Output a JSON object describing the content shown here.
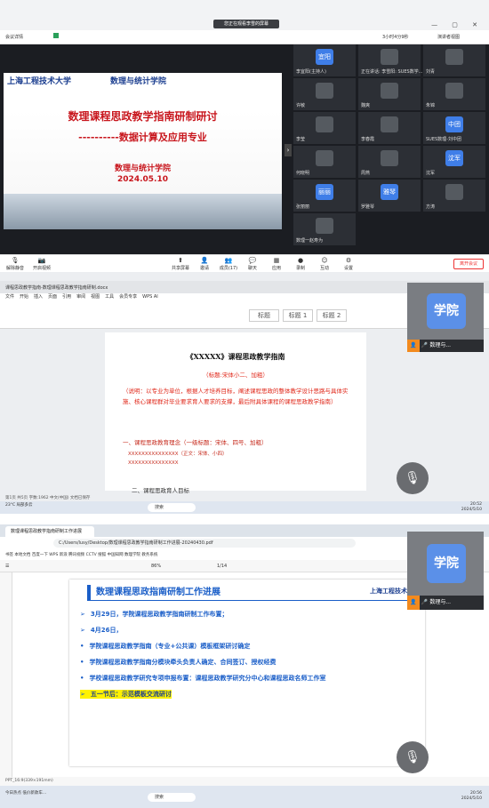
{
  "panel1": {
    "share_status": "您正在观看李雪的屏幕",
    "meeting_info": "会议详情",
    "timer": "3小时4分9秒",
    "view_label": "演讲者视图",
    "slide": {
      "school_name": "上海工程技术大学",
      "college_name": "数理与统计学院",
      "title": "数理课程思政教学指南研制研讨",
      "subtitle": "----------数据计算及应用专业",
      "college": "数理与统计学院",
      "date": "2024.05.10"
    },
    "participants": [
      {
        "avatar": "宜阳",
        "name": "李宜阳(主持人)",
        "color": "#3f7ee8"
      },
      {
        "avatar": "",
        "name": "正在讲话: 李雪阳: SUES数学...",
        "color": "#555a60"
      },
      {
        "avatar": "",
        "name": "刘青",
        "color": "#555a60"
      },
      {
        "avatar": "",
        "name": "许敏",
        "color": "#555a60"
      },
      {
        "avatar": "",
        "name": "魏爽",
        "color": "#555a60"
      },
      {
        "avatar": "",
        "name": "朱锦",
        "color": "#555a60"
      },
      {
        "avatar": "",
        "name": "李莹",
        "color": "#555a60"
      },
      {
        "avatar": "",
        "name": "李春霞",
        "color": "#555a60"
      },
      {
        "avatar": "中团",
        "name": "SUES数理-刘中团",
        "color": "#3f7ee8"
      },
      {
        "avatar": "",
        "name": "何晓明",
        "color": "#555a60"
      },
      {
        "avatar": "",
        "name": "周燕",
        "color": "#555a60"
      },
      {
        "avatar": "沈军",
        "name": "沈军",
        "color": "#3f7ee8"
      },
      {
        "avatar": "丽丽",
        "name": "张丽丽",
        "color": "#3f7ee8"
      },
      {
        "avatar": "雅琴",
        "name": "罗雅琴",
        "color": "#3f7ee8"
      },
      {
        "avatar": "",
        "name": "方涛",
        "color": "#555a60"
      },
      {
        "avatar": "",
        "name": "数理一赵寿为",
        "color": "#555a60"
      }
    ],
    "toolbar": {
      "mute": "解除静音",
      "video": "开启视频",
      "share": "共享屏幕",
      "invite": "邀请",
      "members": "成员(17)",
      "chat": "聊天",
      "apps": "应用",
      "record": "录制",
      "roles": "互动",
      "settings": "设置",
      "leave": "离开会议"
    }
  },
  "panel2": {
    "tab": "课程思政教学指南-数理课程思政教学指南研制.docx",
    "menus": [
      "文件",
      "开始",
      "插入",
      "页面",
      "引用",
      "审阅",
      "视图",
      "工具",
      "会员专享",
      "WPS AI"
    ],
    "styles": [
      "标题",
      "标题 1",
      "标题 2"
    ],
    "doc": {
      "heading": "《XXXXX》课程思政教学指南",
      "subheading": "（标题:宋体小二、加粗）",
      "description": "（说明：以专业为单位，根据人才培养目标，阐述课程思政的整体教学设计思路与具体实施、核心课程群对毕业要求育人要求的支撑，最后附具体课程的课程思政教学指南）",
      "section1": "一、课程思政教育理念（一级标题：宋体、四号、加粗）",
      "body1": "XXXXXXXXXXXXXXX（正文：宋体、小四）",
      "body2": "XXXXXXXXXXXXXXX",
      "section2": "二、课程思政育人目标"
    },
    "status": "第1页 共5页 字数:1962  中文(中国)  文档已保存",
    "taskbar_weather": "23°C 局部多云",
    "taskbar_search": "搜索",
    "clock_time": "20:52",
    "clock_date": "2024/5/10",
    "video_name": "学院",
    "video_label": "数理与..."
  },
  "panel3": {
    "tab": "数理课程思政教学指南研制工作进展",
    "url": "C:/Users/lusy/Desktop/数理课程思政教学指南研制工作进展-20240430.pdf",
    "bookmarks": "书签  本地文档  百度一下  WPS  新浪  腾讯视频  CCTV  搜狐  中国知网  数理学院  教务系统",
    "pdf_page": "1/14",
    "zoom": "86%",
    "pdf": {
      "title": "数理课程思政指南研制工作进展",
      "logo": "上海工程技术大学",
      "items": [
        {
          "text": "3月29日，学院课程思政教学指南研制工作布置；",
          "mark": "➢",
          "hl": false
        },
        {
          "text": "4月26日，",
          "mark": "➢",
          "hl": false
        },
        {
          "text": "学院课程思政教学指南（专业+公共课）模板框架研讨确定",
          "mark": "•",
          "hl": false
        },
        {
          "text": "学院课程思政教学指南分模块牵头负责人确定、合同签订、授权经费",
          "mark": "•",
          "hl": false
        },
        {
          "text": "学校课程思政教学研究专项申报布置：课程思政教学研究分中心和课程思政名师工作室",
          "mark": "•",
          "hl": false
        },
        {
          "text": "五一节后：示范模板交流研讨",
          "mark": "➢",
          "hl": true
        }
      ]
    },
    "statusbar": "PPT_16:9(339×191mm)",
    "taskbar_weather": "今日热点 低价新款车...",
    "taskbar_search": "搜索",
    "clock_time": "20:56",
    "clock_date": "2024/5/10",
    "video_name": "学院",
    "video_label": "数理与..."
  }
}
